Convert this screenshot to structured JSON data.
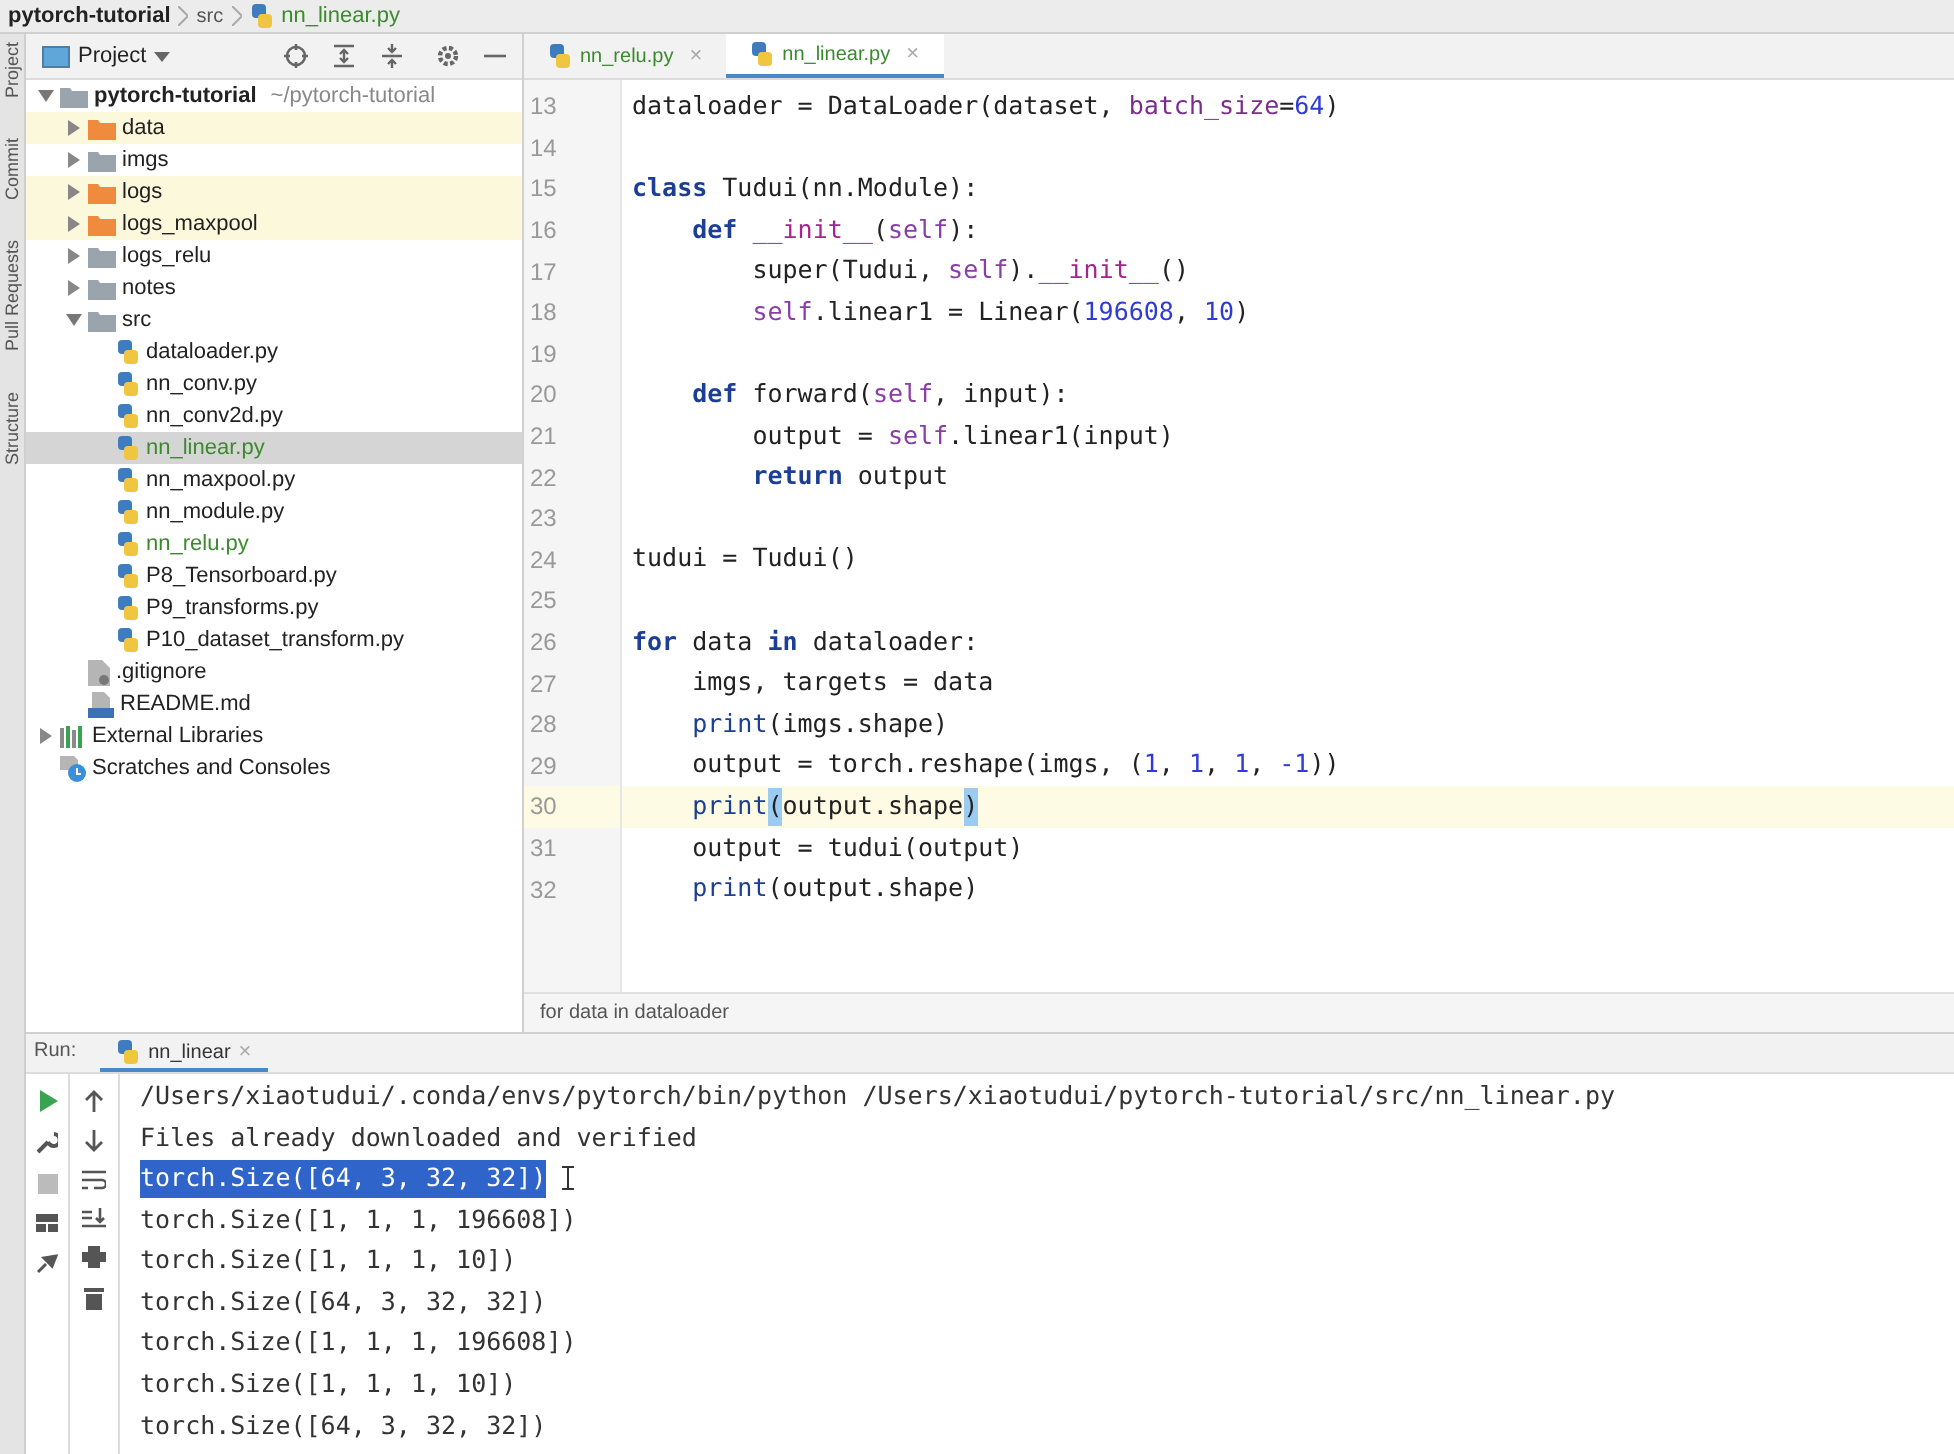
{
  "breadcrumb": [
    "pytorch-tutorial",
    "src",
    "nn_linear.py"
  ],
  "side_strip": [
    "Project",
    "Commit",
    "Pull Requests",
    "Structure"
  ],
  "project_panel": {
    "title": "Project",
    "tree": [
      {
        "label": "pytorch-tutorial",
        "hint": "~/pytorch-tutorial",
        "kind": "folder",
        "expanded": true,
        "excluded": false,
        "selected": false,
        "children": [
          {
            "label": "data",
            "kind": "folder",
            "expanded": false,
            "excluded": true,
            "selected": false
          },
          {
            "label": "imgs",
            "kind": "folder",
            "expanded": false,
            "excluded": false,
            "selected": false
          },
          {
            "label": "logs",
            "kind": "folder",
            "expanded": false,
            "excluded": true,
            "selected": false
          },
          {
            "label": "logs_maxpool",
            "kind": "folder",
            "expanded": false,
            "excluded": true,
            "selected": false
          },
          {
            "label": "logs_relu",
            "kind": "folder",
            "expanded": false,
            "excluded": false,
            "selected": false
          },
          {
            "label": "notes",
            "kind": "folder",
            "expanded": false,
            "excluded": false,
            "selected": false
          },
          {
            "label": "src",
            "kind": "folder",
            "expanded": true,
            "excluded": false,
            "selected": false,
            "children": [
              {
                "label": "dataloader.py",
                "kind": "python",
                "modified": false,
                "selected": false
              },
              {
                "label": "nn_conv.py",
                "kind": "python",
                "modified": false,
                "selected": false
              },
              {
                "label": "nn_conv2d.py",
                "kind": "python",
                "modified": false,
                "selected": false
              },
              {
                "label": "nn_linear.py",
                "kind": "python",
                "modified": true,
                "selected": true
              },
              {
                "label": "nn_maxpool.py",
                "kind": "python",
                "modified": false,
                "selected": false
              },
              {
                "label": "nn_module.py",
                "kind": "python",
                "modified": false,
                "selected": false
              },
              {
                "label": "nn_relu.py",
                "kind": "python",
                "modified": true,
                "selected": false
              },
              {
                "label": "P8_Tensorboard.py",
                "kind": "python",
                "modified": false,
                "selected": false
              },
              {
                "label": "P9_transforms.py",
                "kind": "python",
                "modified": false,
                "selected": false
              },
              {
                "label": "P10_dataset_transform.py",
                "kind": "python",
                "modified": false,
                "selected": false
              }
            ]
          },
          {
            "label": ".gitignore",
            "kind": "file",
            "selected": false
          },
          {
            "label": "README.md",
            "kind": "markdown",
            "selected": false
          }
        ]
      },
      {
        "label": "External Libraries",
        "kind": "libraries",
        "expanded": false,
        "selected": false
      },
      {
        "label": "Scratches and Consoles",
        "kind": "scratches",
        "selected": false
      }
    ]
  },
  "editor_tabs": [
    {
      "label": "nn_relu.py",
      "close": "×",
      "selected": false
    },
    {
      "label": "nn_linear.py",
      "close": "×",
      "selected": true
    }
  ],
  "code_lines": [
    {
      "number": "13",
      "current": false,
      "segments": [
        {
          "t": "dataloader = DataLoader(dataset, ",
          "kind": "plain"
        },
        {
          "t": "batch_size",
          "kind": "kwarg"
        },
        {
          "t": "=",
          "kind": "plain"
        },
        {
          "t": "64",
          "kind": "number"
        },
        {
          "t": ")",
          "kind": "plain"
        }
      ]
    },
    {
      "number": "14",
      "current": false
    },
    {
      "number": "15",
      "current": false,
      "segments": [
        {
          "t": "class ",
          "kind": "keyword"
        },
        {
          "t": "Tudui(nn.Module):",
          "kind": "plain"
        }
      ]
    },
    {
      "number": "16",
      "current": false,
      "segments": [
        {
          "t": "    def ",
          "kind": "keyword"
        },
        {
          "t": "__init__",
          "kind": "dunder"
        },
        {
          "t": "(",
          "kind": "plain"
        },
        {
          "t": "self",
          "kind": "self"
        },
        {
          "t": "):",
          "kind": "plain"
        }
      ]
    },
    {
      "number": "17",
      "current": false,
      "segments": [
        {
          "t": "        super(Tudui, ",
          "kind": "plain"
        },
        {
          "t": "self",
          "kind": "self"
        },
        {
          "t": ").",
          "kind": "plain"
        },
        {
          "t": "__init__",
          "kind": "dunder"
        },
        {
          "t": "()",
          "kind": "plain"
        }
      ]
    },
    {
      "number": "18",
      "current": false,
      "segments": [
        {
          "t": "        self",
          "kind": "self"
        },
        {
          "t": ".linear1 = Linear(",
          "kind": "plain"
        },
        {
          "t": "196608",
          "kind": "number"
        },
        {
          "t": ", ",
          "kind": "plain"
        },
        {
          "t": "10",
          "kind": "number"
        },
        {
          "t": ")",
          "kind": "plain"
        }
      ]
    },
    {
      "number": "19",
      "current": false
    },
    {
      "number": "20",
      "current": false,
      "segments": [
        {
          "t": "    def ",
          "kind": "keyword"
        },
        {
          "t": "forward(",
          "kind": "plain"
        },
        {
          "t": "self",
          "kind": "self"
        },
        {
          "t": ", input):",
          "kind": "plain"
        }
      ]
    },
    {
      "number": "21",
      "current": false,
      "segments": [
        {
          "t": "        output = ",
          "kind": "plain"
        },
        {
          "t": "self",
          "kind": "self"
        },
        {
          "t": ".linear1(input)",
          "kind": "plain"
        }
      ]
    },
    {
      "number": "22",
      "current": false,
      "segments": [
        {
          "t": "        return ",
          "kind": "keyword"
        },
        {
          "t": "output",
          "kind": "plain"
        }
      ]
    },
    {
      "number": "23",
      "current": false
    },
    {
      "number": "24",
      "current": false,
      "segments": [
        {
          "t": "tudui = Tudui()",
          "kind": "plain"
        }
      ]
    },
    {
      "number": "25",
      "current": false
    },
    {
      "number": "26",
      "current": false,
      "segments": [
        {
          "t": "for ",
          "kind": "keyword"
        },
        {
          "t": "data ",
          "kind": "plain"
        },
        {
          "t": "in ",
          "kind": "keyword"
        },
        {
          "t": "dataloader:",
          "kind": "plain"
        }
      ]
    },
    {
      "number": "27",
      "current": false,
      "segments": [
        {
          "t": "    imgs, targets = data",
          "kind": "plain"
        }
      ]
    },
    {
      "number": "28",
      "current": false,
      "segments": [
        {
          "t": "    print",
          "kind": "builtin"
        },
        {
          "t": "(imgs.shape)",
          "kind": "plain"
        }
      ]
    },
    {
      "number": "29",
      "current": false,
      "segments": [
        {
          "t": "    output = torch.reshape(imgs, (",
          "kind": "plain"
        },
        {
          "t": "1",
          "kind": "number"
        },
        {
          "t": ", ",
          "kind": "plain"
        },
        {
          "t": "1",
          "kind": "number"
        },
        {
          "t": ", ",
          "kind": "plain"
        },
        {
          "t": "1",
          "kind": "number"
        },
        {
          "t": ", ",
          "kind": "plain"
        },
        {
          "t": "-1",
          "kind": "number"
        },
        {
          "t": "))",
          "kind": "plain"
        }
      ]
    },
    {
      "number": "30",
      "current": true,
      "segments": [
        {
          "t": "    print",
          "kind": "builtin"
        },
        {
          "t": "(",
          "kind": "match"
        },
        {
          "t": "output.shape",
          "kind": "plain"
        },
        {
          "t": ")",
          "kind": "match"
        }
      ]
    },
    {
      "number": "31",
      "current": false,
      "segments": [
        {
          "t": "    output = tudui(output)",
          "kind": "plain"
        }
      ]
    },
    {
      "number": "32",
      "current": false,
      "segments": [
        {
          "t": "    print",
          "kind": "builtin"
        },
        {
          "t": "(output.shape)",
          "kind": "plain"
        }
      ]
    }
  ],
  "editor_breadcrumb": "for data in dataloader",
  "run_panel": {
    "label": "Run:",
    "tab": "nn_linear",
    "tab_close": "×",
    "output": [
      {
        "text": "/Users/xiaotudui/.conda/envs/pytorch/bin/python /Users/xiaotudui/pytorch-tutorial/src/nn_linear.py",
        "selected": false
      },
      {
        "text": "Files already downloaded and verified",
        "selected": false
      },
      {
        "text": "torch.Size([64, 3, 32, 32])",
        "selected": true
      },
      {
        "text": "torch.Size([1, 1, 1, 196608])",
        "selected": false
      },
      {
        "text": "torch.Size([1, 1, 1, 10])",
        "selected": false
      },
      {
        "text": "torch.Size([64, 3, 32, 32])",
        "selected": false
      },
      {
        "text": "torch.Size([1, 1, 1, 196608])",
        "selected": false
      },
      {
        "text": "torch.Size([1, 1, 1, 10])",
        "selected": false
      },
      {
        "text": "torch.Size([64, 3, 32, 32])",
        "selected": false
      }
    ]
  }
}
